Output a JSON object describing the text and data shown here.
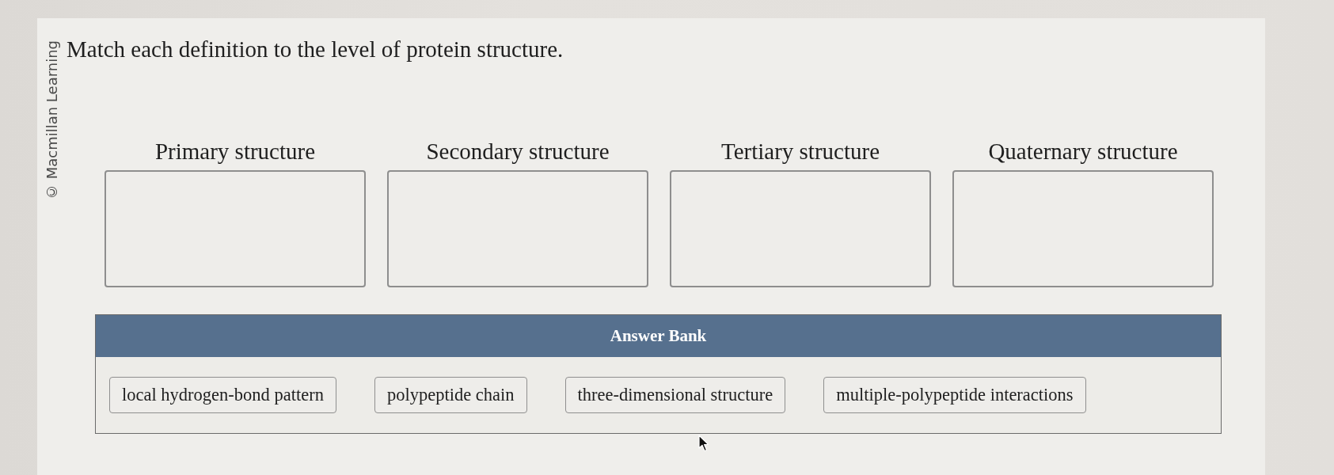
{
  "copyright": "© Macmillan Learning",
  "question": "Match each definition to the level of protein structure.",
  "targets": [
    {
      "label": "Primary structure"
    },
    {
      "label": "Secondary structure"
    },
    {
      "label": "Tertiary structure"
    },
    {
      "label": "Quaternary structure"
    }
  ],
  "answer_bank": {
    "title": "Answer Bank",
    "items": [
      "local hydrogen-bond pattern",
      "polypeptide chain",
      "three-dimensional structure",
      "multiple-polypeptide interactions"
    ]
  }
}
